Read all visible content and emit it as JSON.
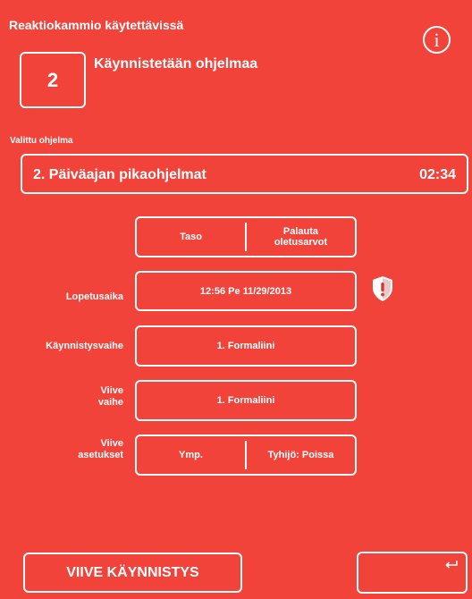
{
  "header": {
    "title": "Reaktiokammio käytettävissä",
    "info_glyph": "i",
    "step_number": "2",
    "step_label": "Käynnistetään ohjelmaa"
  },
  "program": {
    "label": "Valittu ohjelma",
    "name": "2. Päiväajan pikaohjelmat",
    "duration": "02:34"
  },
  "settings": {
    "level_label": "Taso",
    "reset_label_line1": "Palauta",
    "reset_label_line2": "oletusarvot",
    "end_time_label": "Lopetusaika",
    "end_time_value": "12:56  Pe 11/29/2013",
    "start_step_label": "Käynnistysvaihe",
    "start_step_value": "1. Formaliini",
    "delay_step_label_line1": "Viive",
    "delay_step_label_line2": "vaihe",
    "delay_step_value": "1. Formaliini",
    "delay_settings_label_line1": "Viive",
    "delay_settings_label_line2": "asetukset",
    "ambient_label": "Ymp.",
    "vacuum_label": "Tyhijö: Poissa"
  },
  "footer": {
    "delay_start_label": "VIIVE KÄYNNISTYS"
  },
  "icons": {
    "info": "info-icon",
    "warning": "warning-shield-icon",
    "back": "return-arrow-icon"
  },
  "colors": {
    "background": "#f1433a",
    "foreground": "#ffffff"
  }
}
